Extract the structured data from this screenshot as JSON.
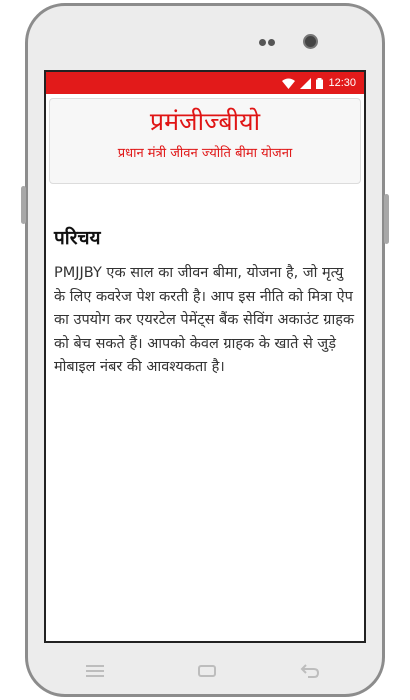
{
  "status_bar": {
    "time": "12:30"
  },
  "header": {
    "title": "प्रमंजीज्बीयो",
    "subtitle": "प्रधान मंत्री जीवन ज्योति बीमा योजना"
  },
  "content": {
    "section_title": "परिचय",
    "paragraph": "PMJJBY एक साल का जीवन बीमा, योजना है, जो मृत्यु के लिए कवरेज पेश करती है। आप इस नीति को मित्रा ऐप का उपयोग कर एयरटेल पेमेंट्स बैंक सेविंग अकाउंट ग्राहक को बेच सकते हैं। आपको केवल ग्राहक के खाते से जुड़े मोबाइल नंबर की आवश्यकता है।"
  },
  "nav_bar": {
    "icons": [
      "menu-icon",
      "home-icon",
      "back-icon"
    ]
  },
  "colors": {
    "accent": "#e21a1a",
    "title_text": "#e01515"
  }
}
